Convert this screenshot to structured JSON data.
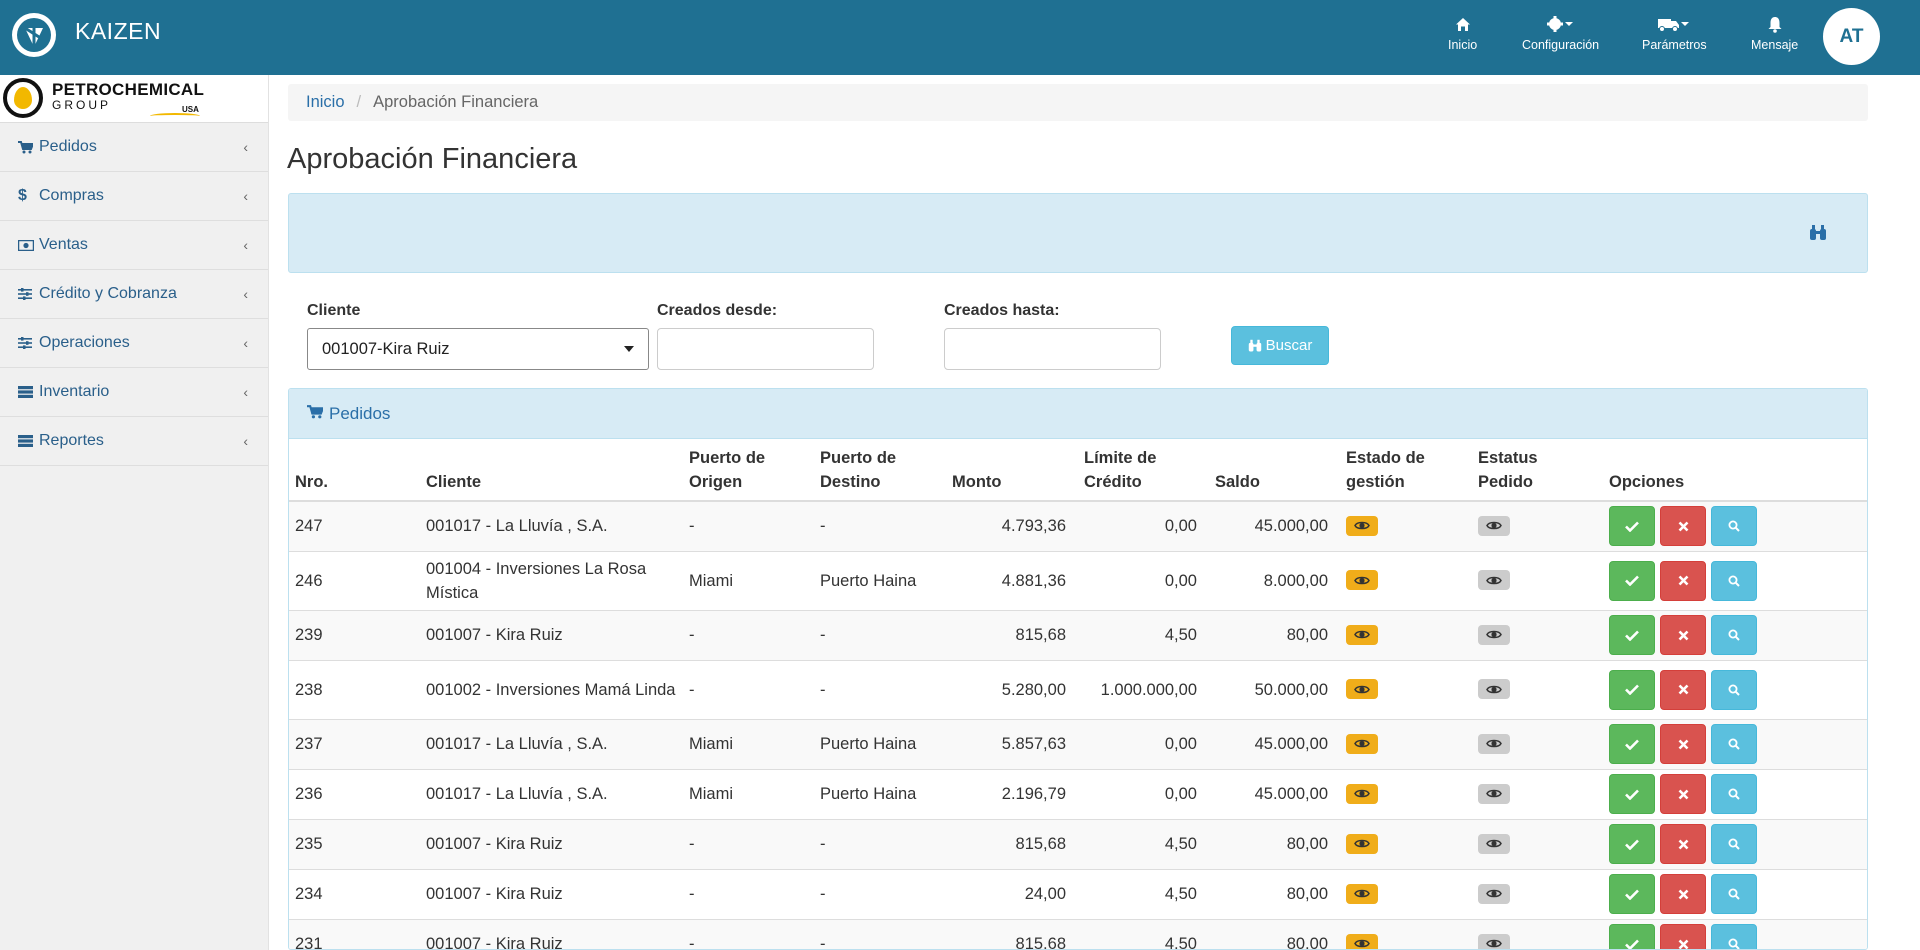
{
  "app": {
    "title": "KAIZEN",
    "avatar_initials": "AT"
  },
  "topnav": [
    {
      "label": "Inicio",
      "icon": "home-icon"
    },
    {
      "label": "Configuración",
      "icon": "gear-icon"
    },
    {
      "label": "Parámetros",
      "icon": "truck-icon"
    },
    {
      "label": "Mensaje",
      "icon": "bell-icon"
    }
  ],
  "brand": {
    "name": "PETROCHEMICAL",
    "sub": "GROUP",
    "region": "USA"
  },
  "sidebar": {
    "items": [
      {
        "label": "Pedidos",
        "icon": "cart-icon"
      },
      {
        "label": "Compras",
        "icon": "dollar-icon"
      },
      {
        "label": "Ventas",
        "icon": "money-icon"
      },
      {
        "label": "Crédito y Cobranza",
        "icon": "sliders-icon"
      },
      {
        "label": "Operaciones",
        "icon": "sliders-icon"
      },
      {
        "label": "Inventario",
        "icon": "server-icon"
      },
      {
        "label": "Reportes",
        "icon": "server-icon"
      }
    ]
  },
  "breadcrumb": {
    "home": "Inicio",
    "current": "Aprobación Financiera"
  },
  "page_title": "Aprobación Financiera",
  "filters": {
    "cliente_label": "Cliente",
    "cliente_value": "001007-Kira Ruiz",
    "desde_label": "Creados desde:",
    "desde_value": "",
    "hasta_label": "Creados hasta:",
    "hasta_value": "",
    "buscar_label": "Buscar"
  },
  "orders": {
    "panel_title": "Pedidos",
    "headers": [
      "Nro.",
      "Cliente",
      "Puerto de Origen",
      "Puerto de Destino",
      "Monto",
      "Límite de Crédito",
      "Saldo",
      "Estado de gestión",
      "Estatus Pedido",
      "Opciones"
    ],
    "rows": [
      {
        "nro": "247",
        "cliente": "001017 - La Lluvía , S.A.",
        "origen": "-",
        "destino": "-",
        "monto": "4.793,36",
        "limite": "0,00",
        "saldo": "45.000,00"
      },
      {
        "nro": "246",
        "cliente": "001004 - Inversiones La Rosa Mística",
        "origen": "Miami",
        "destino": "Puerto Haina",
        "monto": "4.881,36",
        "limite": "0,00",
        "saldo": "8.000,00"
      },
      {
        "nro": "239",
        "cliente": "001007 - Kira Ruiz",
        "origen": "-",
        "destino": "-",
        "monto": "815,68",
        "limite": "4,50",
        "saldo": "80,00"
      },
      {
        "nro": "238",
        "cliente": "001002 - Inversiones Mamá Linda",
        "origen": "-",
        "destino": "-",
        "monto": "5.280,00",
        "limite": "1.000.000,00",
        "saldo": "50.000,00"
      },
      {
        "nro": "237",
        "cliente": "001017 - La Lluvía , S.A.",
        "origen": "Miami",
        "destino": "Puerto Haina",
        "monto": "5.857,63",
        "limite": "0,00",
        "saldo": "45.000,00"
      },
      {
        "nro": "236",
        "cliente": "001017 - La Lluvía , S.A.",
        "origen": "Miami",
        "destino": "Puerto Haina",
        "monto": "2.196,79",
        "limite": "0,00",
        "saldo": "45.000,00"
      },
      {
        "nro": "235",
        "cliente": "001007 - Kira Ruiz",
        "origen": "-",
        "destino": "-",
        "monto": "815,68",
        "limite": "4,50",
        "saldo": "80,00"
      },
      {
        "nro": "234",
        "cliente": "001007 - Kira Ruiz",
        "origen": "-",
        "destino": "-",
        "monto": "24,00",
        "limite": "4,50",
        "saldo": "80,00"
      },
      {
        "nro": "231",
        "cliente": "001007 - Kira Ruiz",
        "origen": "-",
        "destino": "-",
        "monto": "815,68",
        "limite": "4,50",
        "saldo": "80,00"
      }
    ]
  },
  "colors": {
    "topbar": "#1f7092",
    "panel": "#d7ebf5",
    "estado": "#f0ad1a",
    "approve": "#5cb85c",
    "reject": "#d9534f",
    "view": "#5bc0de"
  }
}
